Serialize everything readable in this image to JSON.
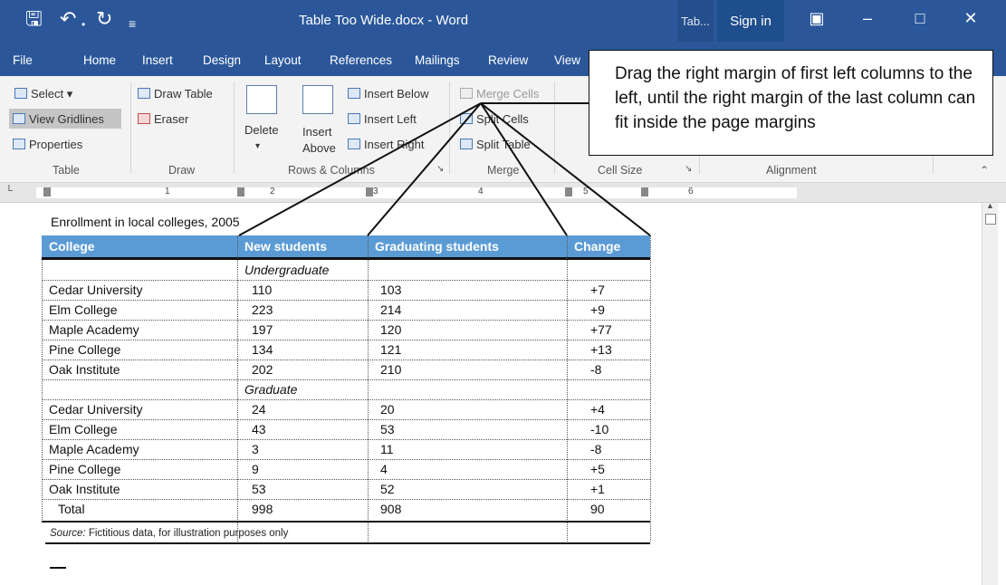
{
  "window": {
    "title": "Table Too Wide.docx  -  Word",
    "table_tools_tab": "Tab...",
    "sign_in": "Sign in"
  },
  "ribbon_tabs": [
    "File",
    "Home",
    "Insert",
    "Design",
    "Layout",
    "References",
    "Mailings",
    "Review",
    "View"
  ],
  "ribbon": {
    "table": {
      "select": "Select ▾",
      "view_gridlines": "View Gridlines",
      "properties": "Properties",
      "label": "Table"
    },
    "draw": {
      "draw_table": "Draw Table",
      "eraser": "Eraser",
      "label": "Draw"
    },
    "rows_cols": {
      "delete": "Delete",
      "insert_above_1": "Insert",
      "insert_above_2": "Above",
      "insert_below": "Insert Below",
      "insert_left": "Insert Left",
      "insert_right": "Insert Right",
      "label": "Rows & Columns"
    },
    "merge": {
      "merge_cells": "Merge Cells",
      "split_cells": "Split Cells",
      "split_table": "Split Table",
      "label": "Merge"
    },
    "cell_size": {
      "label": "Cell Size"
    },
    "alignment": {
      "label": "Alignment"
    }
  },
  "ruler": {
    "numbers": [
      "1",
      "2",
      "3",
      "4",
      "5",
      "6"
    ]
  },
  "document": {
    "caption": "Enrollment in local colleges, 2005",
    "columns": [
      "College",
      "New students",
      "Graduating students",
      "Change"
    ],
    "rows": [
      {
        "college": "",
        "new": "Undergraduate",
        "grad": "",
        "change": "",
        "section": true
      },
      {
        "college": "Cedar University",
        "new": "110",
        "grad": "103",
        "change": "+7"
      },
      {
        "college": "Elm College",
        "new": "223",
        "grad": "214",
        "change": "+9"
      },
      {
        "college": "Maple Academy",
        "new": "197",
        "grad": "120",
        "change": "+77"
      },
      {
        "college": "Pine College",
        "new": "134",
        "grad": "121",
        "change": "+13"
      },
      {
        "college": "Oak Institute",
        "new": "202",
        "grad": "210",
        "change": "-8"
      },
      {
        "college": "",
        "new": "Graduate",
        "grad": "",
        "change": "",
        "section": true
      },
      {
        "college": "Cedar University",
        "new": "24",
        "grad": "20",
        "change": "+4"
      },
      {
        "college": "Elm College",
        "new": "43",
        "grad": "53",
        "change": "-10"
      },
      {
        "college": "Maple Academy",
        "new": "3",
        "grad": "11",
        "change": "-8"
      },
      {
        "college": "Pine College",
        "new": "9",
        "grad": "4",
        "change": "+5"
      },
      {
        "college": "Oak Institute",
        "new": "53",
        "grad": "52",
        "change": "+1"
      },
      {
        "college": "Total",
        "new": "998",
        "grad": "908",
        "change": "90",
        "total": true
      }
    ],
    "source_label": "Source:",
    "source_text": " Fictitious data, for illustration purposes only"
  },
  "callout": {
    "text": "Drag the right margin of first left columns to the left, until the right margin of the last column can fit inside the page margins"
  },
  "colors": {
    "title_bar": "#2b579a",
    "header_fill": "#5b9bd5"
  }
}
